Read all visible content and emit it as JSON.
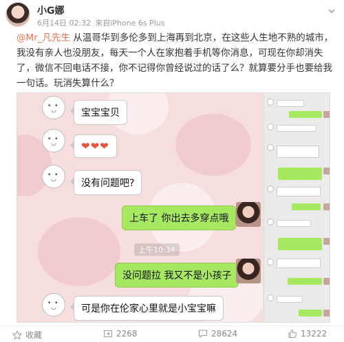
{
  "post": {
    "author": "小G娜",
    "date": "6月14日 02:32",
    "source": "来自iPhone 6s Plus",
    "mention": "@Mr_凡先生",
    "text": " 从温哥华到多伦多到上海再到北京，在这些人生地不熟的城市，我没有亲人也没朋友，每天一个人在家抱着手机等你消息，可现在你却消失了，微信不回电话不接，你不记得你曾经说过的话了么？就算要分手也要给我一句话。玩消失算什么？"
  },
  "chat": {
    "messages": [
      {
        "side": "left",
        "text": "宝宝宝贝"
      },
      {
        "side": "left",
        "text": "❤❤❤"
      },
      {
        "side": "left",
        "text": "没有问题吧?"
      },
      {
        "side": "right",
        "text": "上车了 你出去多穿点哦"
      },
      {
        "side": "right",
        "text": "没问题拉 我又不是小孩子"
      },
      {
        "side": "left",
        "text": "可是你在伦家心里就是小宝宝嘛"
      }
    ],
    "timestamp": "上午10:34"
  },
  "footer": {
    "favorite": "收藏",
    "repost": "2268",
    "comment": "28624",
    "like": "13222"
  },
  "colors": {
    "mention": "#eb7350",
    "bubble_green": "#a6e860",
    "chat_bg": "#f6dede"
  }
}
